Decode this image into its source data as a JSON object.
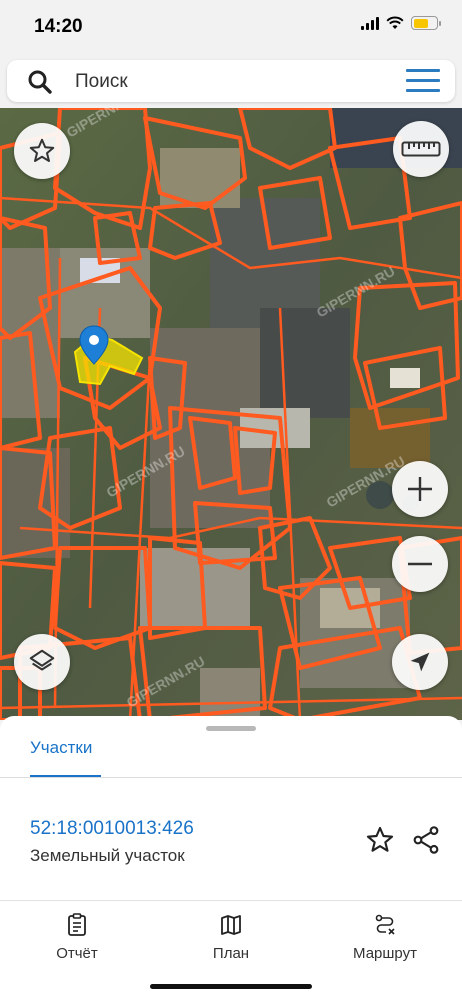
{
  "status_bar": {
    "time": "14:20",
    "battery_level": 0.56
  },
  "search": {
    "placeholder": "Поиск"
  },
  "map": {
    "watermark": "GIPERNN.RU",
    "parcel_outline_color": "#ff5a1f",
    "selected_parcel_color": "#f5e400"
  },
  "map_controls": {
    "favorites": "star-icon",
    "ruler": "ruler-icon",
    "zoom_in": "plus-icon",
    "zoom_out": "minus-icon",
    "layers": "layers-icon",
    "locate": "navigation-arrow-icon"
  },
  "sheet": {
    "tab_label": "Участки",
    "parcel": {
      "id": "52:18:0010013:426",
      "type": "Земельный участок"
    }
  },
  "bottom_nav": [
    {
      "label": "Отчёт",
      "icon": "report-icon"
    },
    {
      "label": "План",
      "icon": "map-plan-icon"
    },
    {
      "label": "Маршрут",
      "icon": "route-icon"
    }
  ],
  "colors": {
    "accent": "#1a73c8",
    "orange": "#ff5a1f",
    "yellow": "#f5e400"
  }
}
